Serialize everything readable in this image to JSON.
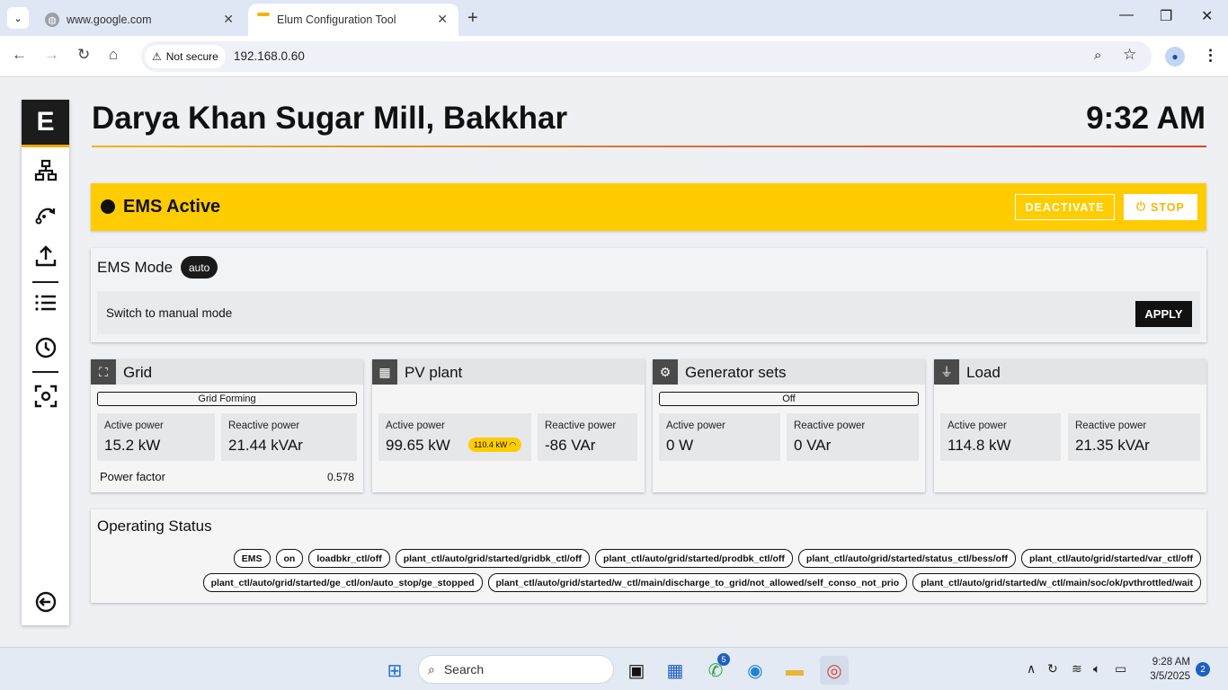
{
  "browser": {
    "tabs": [
      {
        "title": "www.google.com",
        "active": false
      },
      {
        "title": "Elum Configuration Tool",
        "active": true
      }
    ],
    "security_label": "Not secure",
    "url": "192.168.0.60"
  },
  "header": {
    "site_title": "Darya Khan Sugar Mill, Bakkhar",
    "time": "9:32 AM"
  },
  "banner": {
    "status": "EMS Active",
    "deactivate_label": "DEACTIVATE",
    "stop_label": "STOP",
    "color": "#ffcc00"
  },
  "ems_mode": {
    "title": "EMS Mode",
    "mode_badge": "auto",
    "switch_label": "Switch to manual mode",
    "apply_label": "APPLY"
  },
  "cards": {
    "grid": {
      "title": "Grid",
      "status": "Grid Forming",
      "active_label": "Active power",
      "active_value": "15.2 kW",
      "reactive_label": "Reactive power",
      "reactive_value": "21.44 kVAr",
      "pf_label": "Power factor",
      "pf_value": "0.578"
    },
    "pv": {
      "title": "PV plant",
      "active_label": "Active power",
      "active_value": "99.65 kW",
      "limit_badge": "110.4 kW",
      "reactive_label": "Reactive power",
      "reactive_value": "-86 VAr"
    },
    "gen": {
      "title": "Generator sets",
      "status": "Off",
      "active_label": "Active power",
      "active_value": "0 W",
      "reactive_label": "Reactive power",
      "reactive_value": "0 VAr"
    },
    "load": {
      "title": "Load",
      "active_label": "Active power",
      "active_value": "114.8 kW",
      "reactive_label": "Reactive power",
      "reactive_value": "21.35 kVAr"
    }
  },
  "operating_status": {
    "title": "Operating Status",
    "row1": [
      "EMS",
      "on",
      "loadbkr_ctl/off",
      "plant_ctl/auto/grid/started/gridbk_ctl/off",
      "plant_ctl/auto/grid/started/prodbk_ctl/off",
      "plant_ctl/auto/grid/started/status_ctl/bess/off",
      "plant_ctl/auto/grid/started/var_ctl/off"
    ],
    "row2": [
      "plant_ctl/auto/grid/started/ge_ctl/on/auto_stop/ge_stopped",
      "plant_ctl/auto/grid/started/w_ctl/main/discharge_to_grid/not_allowed/self_conso_not_prio",
      "plant_ctl/auto/grid/started/w_ctl/main/soc/ok/pvthrottled/wait"
    ]
  },
  "taskbar": {
    "search_label": "Search",
    "whatsapp_badge": "5",
    "time": "9:28 AM",
    "date": "3/5/2025",
    "notifications": "2"
  }
}
